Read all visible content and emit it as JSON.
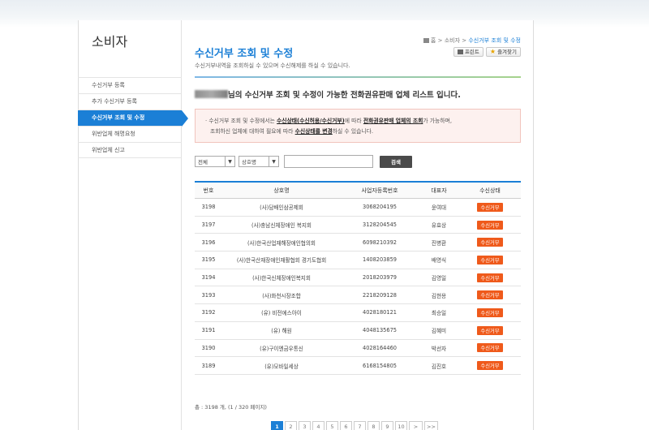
{
  "sidebar": {
    "title": "소비자",
    "items": [
      {
        "label": "수신거부 등록"
      },
      {
        "label": "추가 수신거부 등록"
      },
      {
        "label": "수신거부 조회 및 수정"
      },
      {
        "label": "위반업체 해명요청"
      },
      {
        "label": "위반업체 신고"
      }
    ]
  },
  "header": {
    "title": "수신거부 조회 및 수정",
    "description": "수신거부내역을 조회하실 수 있으며 수신해제를 하실 수 있습니다.",
    "breadcrumb": {
      "home": "홈",
      "sep1": ">",
      "level1": "소비자",
      "sep2": ">",
      "current": "수신거부 조회 및 수정"
    },
    "print_label": "프린트",
    "favorite_label": "즐겨찾기"
  },
  "headline_suffix": "님의 수신거부 조회 및 수정이 가능한 전화권유판매 업체 리스트 입니다.",
  "notice": {
    "bullet": "·",
    "p1": "수신거부 조회 및 수정에서는 ",
    "u1": "수신상태(수신허용/수신거부)",
    "p2": "에 따라 ",
    "u2": "전화권유판매 업체의 조회",
    "p3": "가 가능하며,",
    "p4": "조회하신 업체에 대하여 필요에 따라 ",
    "u3": "수신상태를 변경",
    "p5": "하실 수 있습니다."
  },
  "search": {
    "filter1": "전체",
    "filter2": "상호명",
    "arrow": "▼",
    "input_value": "",
    "button_label": "검색"
  },
  "table": {
    "headers": [
      "번호",
      "상호명",
      "사업자등록번호",
      "대표자",
      "수신상태"
    ],
    "rows": [
      [
        "3198",
        "(사)담배인삼공제회",
        "3068204195",
        "윤여대",
        "수신거부"
      ],
      [
        "3197",
        "(사)충남신체장애인 복지회",
        "3128204545",
        "유효상",
        "수신거부"
      ],
      [
        "3196",
        "(사)한국산업재해장애인협의회",
        "6098210392",
        "진병환",
        "수신거부"
      ],
      [
        "3195",
        "(사)한국산재장애인재활협회 경기도협회",
        "1408203859",
        "배영식",
        "수신거부"
      ],
      [
        "3194",
        "(사)한국신체장애인복지회",
        "2018203979",
        "김영일",
        "수신거부"
      ],
      [
        "3193",
        "(사)화천시장조합",
        "2218209128",
        "김현용",
        "수신거부"
      ],
      [
        "3192",
        "(유) 비전에스아이",
        "4028180121",
        "최승일",
        "수신거부"
      ],
      [
        "3191",
        "(유) 해원",
        "4048135675",
        "김혜미",
        "수신거부"
      ],
      [
        "3190",
        "(유)구이엔금우통신",
        "4028164460",
        "박선자",
        "수신거부"
      ],
      [
        "3189",
        "(유)모바일세상",
        "6168154805",
        "김진호",
        "수신거부"
      ]
    ]
  },
  "total_text": "총 : 3198 개, (1 / 320 페이지)",
  "pagination": {
    "pages": [
      "1",
      "2",
      "3",
      "4",
      "5",
      "6",
      "7",
      "8",
      "9",
      "10"
    ],
    "next": ">",
    "last": ">>",
    "current": "1"
  },
  "colors": {
    "accent": "#1b7fd6",
    "status": "#ef5a1b"
  }
}
